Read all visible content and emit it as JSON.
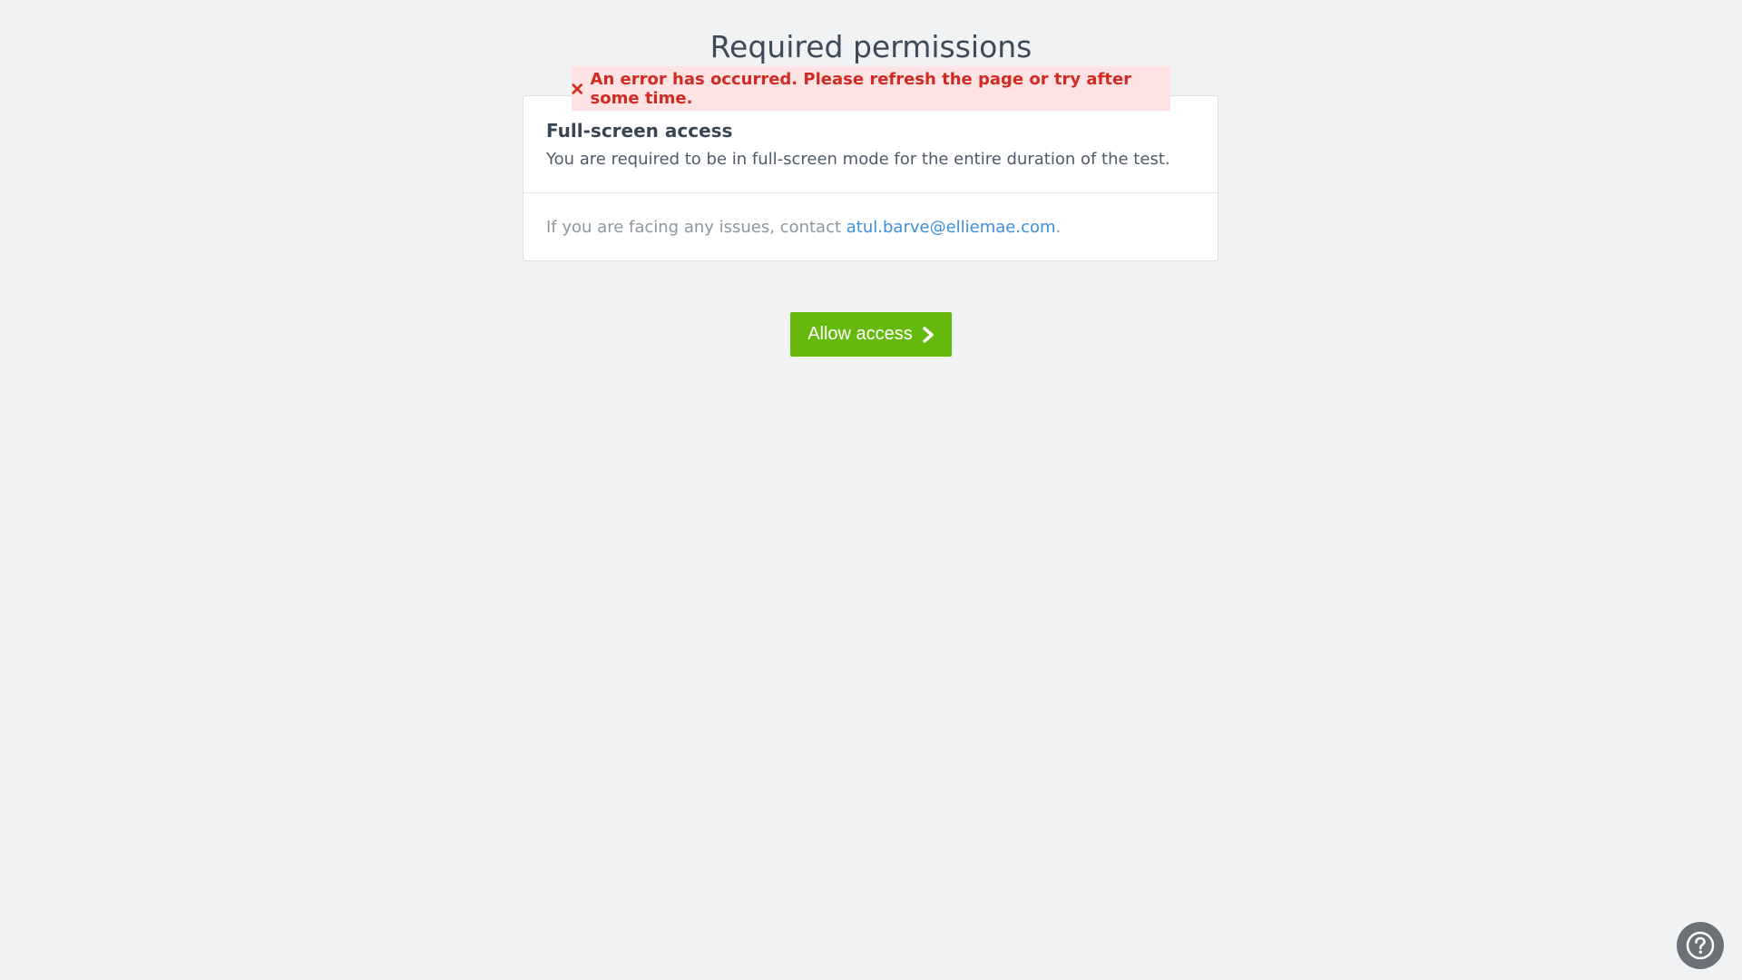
{
  "page": {
    "title": "Required permissions"
  },
  "error": {
    "message": "An error has occurred. Please refresh the page or try after some time.",
    "icon": "close-icon",
    "color": "#cf2b22",
    "background": "#fde3e3"
  },
  "permission": {
    "title": "Full-screen access",
    "description": "You are required to be in full-screen mode for the entire duration of the test."
  },
  "contact": {
    "prefix": "If you are facing any issues, contact ",
    "email": "atul.barve@elliemae.com",
    "suffix": "."
  },
  "actions": {
    "allow_label": "Allow access",
    "allow_icon": "chevron-right-icon",
    "allow_color": "#65b90c"
  },
  "help": {
    "icon": "question-circle-icon"
  }
}
